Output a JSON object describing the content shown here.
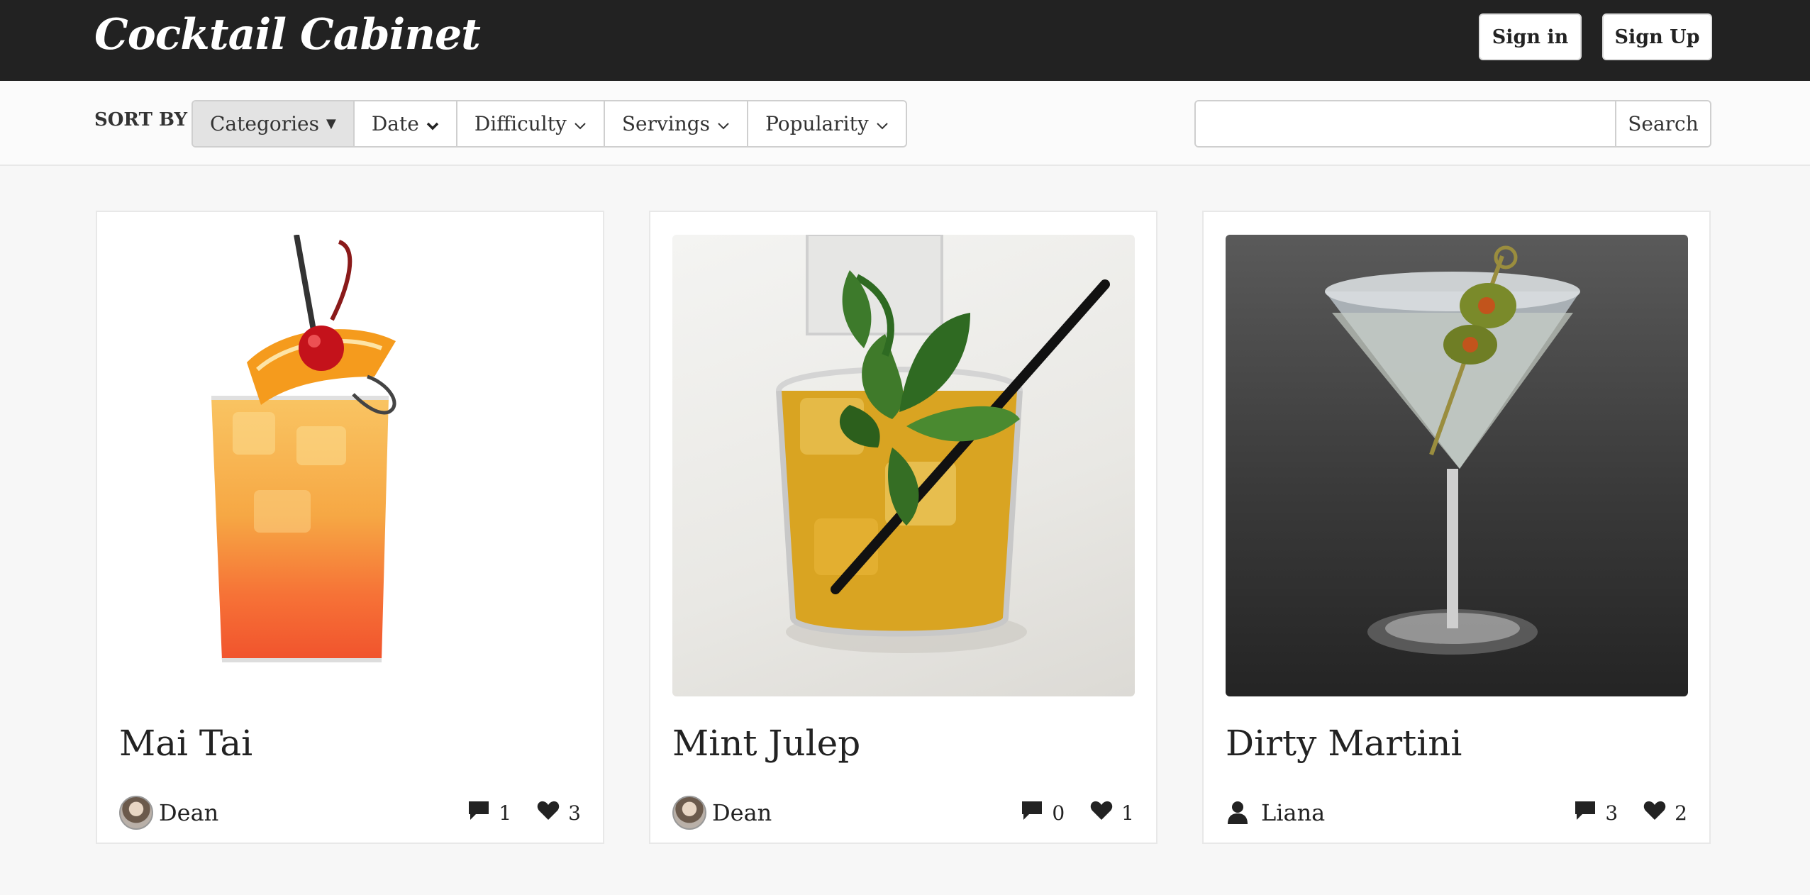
{
  "header": {
    "brand": "Cocktail Cabinet",
    "sign_in": "Sign in",
    "sign_up": "Sign Up"
  },
  "sortbar": {
    "label": "SORT BY",
    "options": [
      {
        "label": "Categories",
        "active": true
      },
      {
        "label": "Date"
      },
      {
        "label": "Difficulty"
      },
      {
        "label": "Servings"
      },
      {
        "label": "Popularity"
      }
    ],
    "search": {
      "value": "",
      "placeholder": "",
      "button": "Search"
    }
  },
  "cards": [
    {
      "title": "Mai Tai",
      "author": "Dean",
      "comments": "1",
      "likes": "3",
      "avatar": "photo"
    },
    {
      "title": "Mint Julep",
      "author": "Dean",
      "comments": "0",
      "likes": "1",
      "avatar": "photo"
    },
    {
      "title": "Dirty Martini",
      "author": "Liana",
      "comments": "3",
      "likes": "2",
      "avatar": "user-icon"
    }
  ],
  "colors": {
    "topbar": "#222222",
    "background": "#f7f7f7",
    "active_sort": "#e3e3e3"
  }
}
